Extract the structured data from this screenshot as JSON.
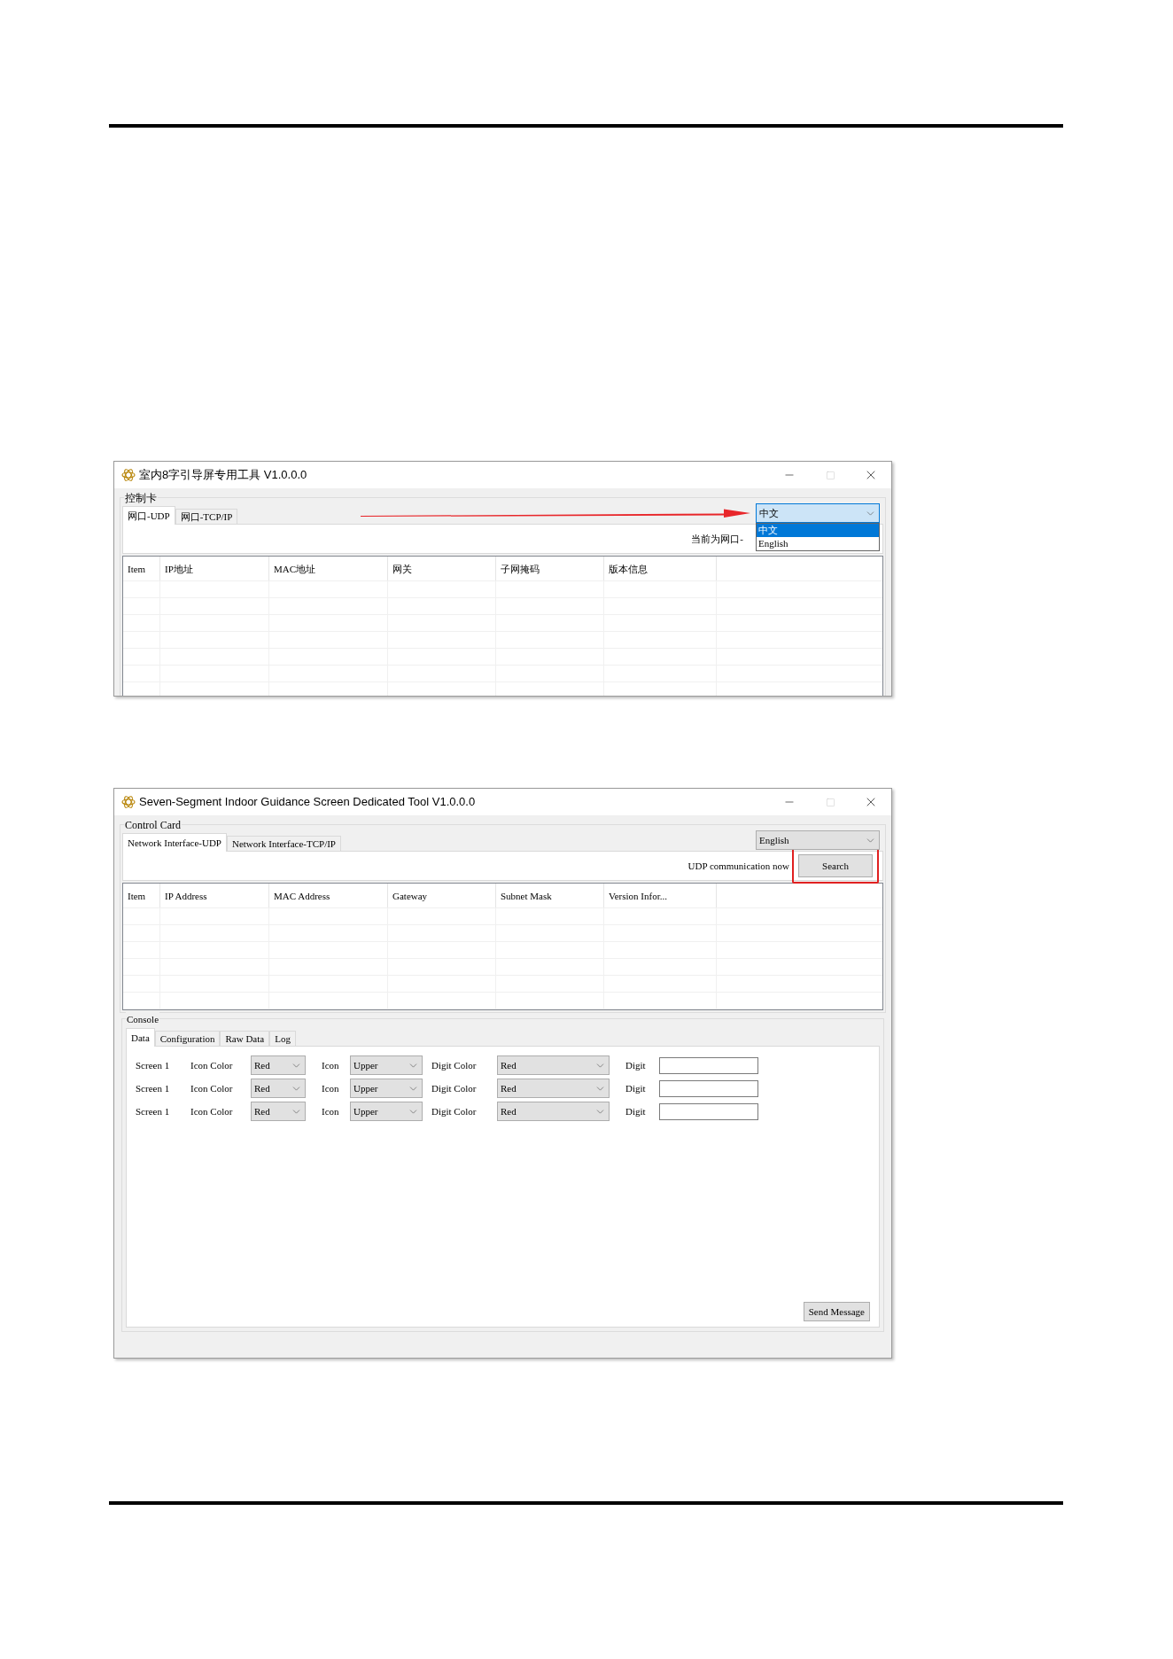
{
  "windows": [
    {
      "title": "室内8字引导屏专用工具 V1.0.0.0",
      "group_label": "控制卡",
      "pointer_arrow": true,
      "tabs": [
        {
          "label": "网口-UDP",
          "selected": true
        },
        {
          "label": "网口-TCP/IP",
          "selected": false
        }
      ],
      "language_select": {
        "value": "中文",
        "expanded": true,
        "options": [
          {
            "label": "中文",
            "selected": true
          },
          {
            "label": "English",
            "selected": false
          }
        ]
      },
      "status_text": "当前为网口-",
      "table": {
        "columns": [
          "Item",
          "IP地址",
          "MAC地址",
          "网关",
          "子网掩码",
          "版本信息"
        ]
      }
    },
    {
      "title": "Seven-Segment Indoor Guidance Screen Dedicated Tool V1.0.0.0",
      "group_label": "Control Card",
      "pointer_arrow": false,
      "tabs": [
        {
          "label": "Network Interface-UDP",
          "selected": true
        },
        {
          "label": "Network Interface-TCP/IP",
          "selected": false
        }
      ],
      "language_select": {
        "value": "English",
        "expanded": false
      },
      "status_text": "UDP communication now",
      "search_button": {
        "label": "Search",
        "highlighted": true
      },
      "table": {
        "columns": [
          "Item",
          "IP Address",
          "MAC Address",
          "Gateway",
          "Subnet Mask",
          "Version Infor..."
        ]
      },
      "console": {
        "label": "Console",
        "tabs": [
          {
            "label": "Data",
            "selected": true
          },
          {
            "label": "Configuration",
            "selected": false
          },
          {
            "label": "Raw Data",
            "selected": false
          },
          {
            "label": "Log",
            "selected": false
          }
        ],
        "rows": [
          {
            "screen": "Screen 1",
            "icon_color_label": "Icon Color",
            "icon_color": "Red",
            "icon_label": "Icon",
            "icon": "Upper",
            "digit_color_label": "Digit Color",
            "digit_color": "Red",
            "digit_label": "Digit"
          },
          {
            "screen": "Screen 1",
            "icon_color_label": "Icon Color",
            "icon_color": "Red",
            "icon_label": "Icon",
            "icon": "Upper",
            "digit_color_label": "Digit Color",
            "digit_color": "Red",
            "digit_label": "Digit"
          },
          {
            "screen": "Screen 1",
            "icon_color_label": "Icon Color",
            "icon_color": "Red",
            "icon_label": "Icon",
            "icon": "Upper",
            "digit_color_label": "Digit Color",
            "digit_color": "Red",
            "digit_label": "Digit"
          }
        ],
        "send_button": "Send Message"
      }
    }
  ]
}
